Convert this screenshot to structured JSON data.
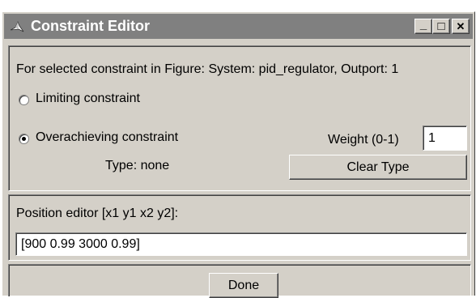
{
  "window": {
    "title": "Constraint Editor",
    "controls": {
      "minimize": "_",
      "maximize": "□",
      "close": "✕"
    }
  },
  "constraint_panel": {
    "description": "For selected constraint in Figure: System: pid_regulator, Outport: 1",
    "options": [
      {
        "label": "Limiting constraint",
        "selected": false
      },
      {
        "label": "Overachieving constraint",
        "selected": true
      }
    ],
    "weight": {
      "label": "Weight (0-1)",
      "value": "1"
    },
    "type_text": "Type: none",
    "clear_type_label": "Clear Type"
  },
  "position_panel": {
    "label": "Position editor [x1 y1 x2 y2]:",
    "value": "[900 0.99 3000 0.99]"
  },
  "footer": {
    "done_label": "Done"
  },
  "icons": {
    "app": "matlab-logo-icon",
    "radio_selected": "radio-selected-icon",
    "radio_unselected": "radio-unselected-icon"
  }
}
